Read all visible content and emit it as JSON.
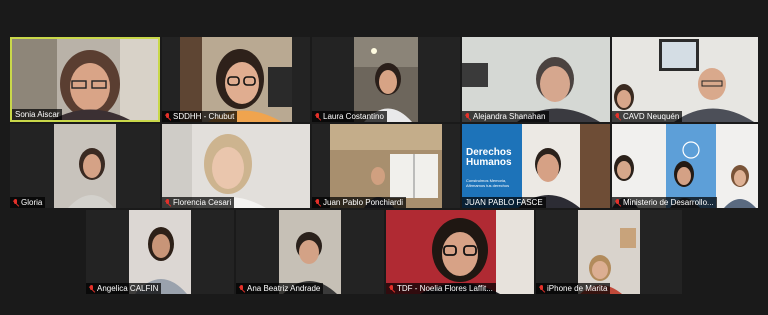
{
  "app": {
    "accent": "#c9d84a",
    "muted_icon": "mic-muted-icon",
    "muted_color": "#e5312a"
  },
  "participants": [
    {
      "id": "p1",
      "name": "Sonia Aiscar",
      "muted": false,
      "active_speaker": true
    },
    {
      "id": "p2",
      "name": "SDDHH - Chubut",
      "muted": true
    },
    {
      "id": "p3",
      "name": "Laura Costantino",
      "muted": true
    },
    {
      "id": "p4",
      "name": "Alejandra Shanahan",
      "muted": true
    },
    {
      "id": "p5",
      "name": "CAVD Neuquén",
      "muted": true
    },
    {
      "id": "p6",
      "name": "Gloria",
      "muted": true
    },
    {
      "id": "p7",
      "name": "Florencia Cesari",
      "muted": true
    },
    {
      "id": "p8",
      "name": "Juan Pablo Ponchiardi",
      "muted": true
    },
    {
      "id": "p9",
      "name": "JUAN PABLO FASCE",
      "muted": false,
      "banner": {
        "line1": "Derechos",
        "line2": "Humanos",
        "line3": "Construimos Memoria, Afirmamos tus derechos"
      }
    },
    {
      "id": "p10",
      "name": "Ministerio de Desarrollo...",
      "muted": true
    },
    {
      "id": "p11",
      "name": "Angelica CALFIN",
      "muted": true
    },
    {
      "id": "p12",
      "name": "Ana Beatriz Andrade",
      "muted": true
    },
    {
      "id": "p13",
      "name": "TDF - Noelia Flores Laffit...",
      "muted": true
    },
    {
      "id": "p14",
      "name": "iPhone de Marita",
      "muted": true
    }
  ]
}
